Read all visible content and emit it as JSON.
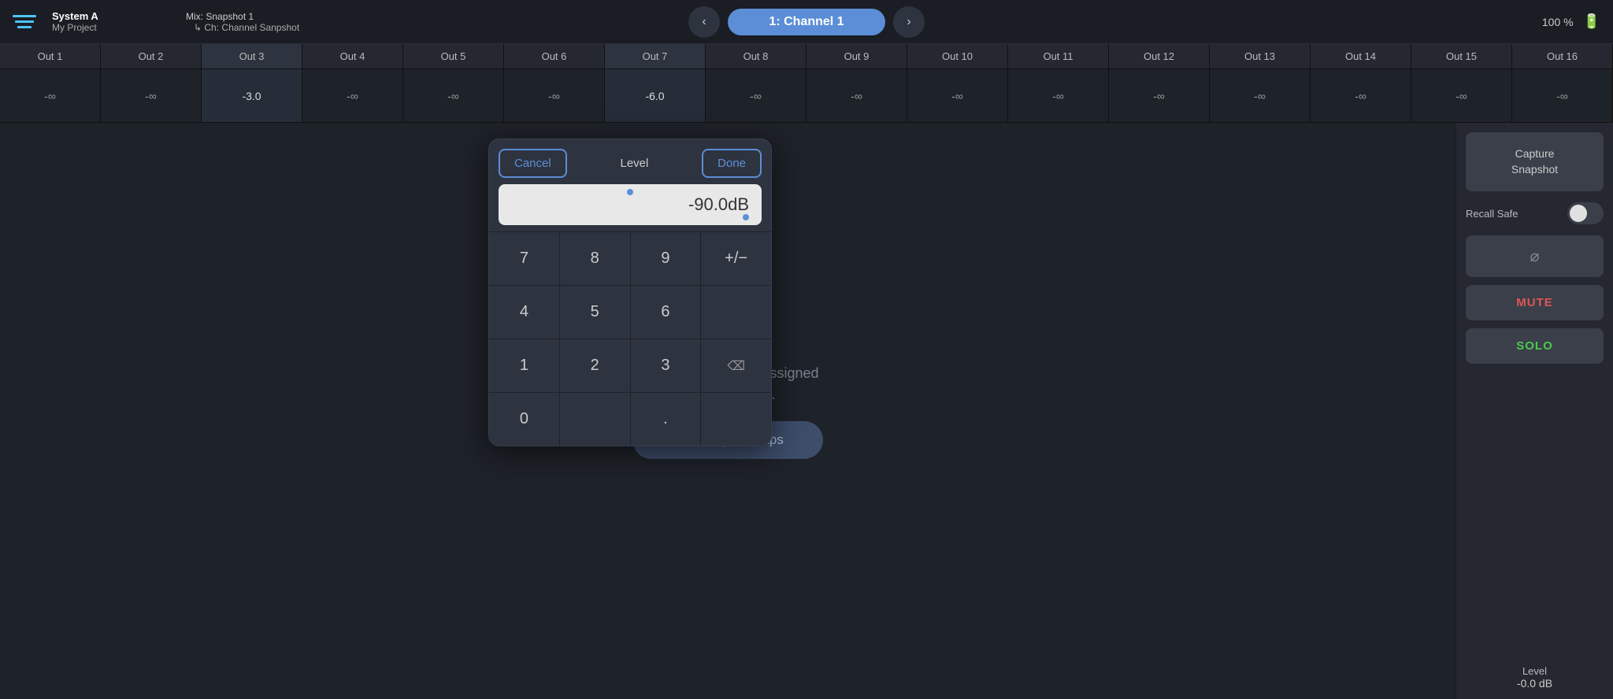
{
  "topbar": {
    "device_name": "System A",
    "project_name": "My Project",
    "mix_label": "Mix:",
    "mix_name": "Snapshot 1",
    "ch_label": "Ch:",
    "ch_name": "Channel Sanpshot",
    "prev_btn": "‹",
    "next_btn": "›",
    "channel_btn": "1: Channel 1",
    "zoom_level": "100 %",
    "battery_icon": "🔋"
  },
  "outputs": [
    {
      "label": "Out 1",
      "value": "-∞"
    },
    {
      "label": "Out 2",
      "value": "-∞"
    },
    {
      "label": "Out 3",
      "value": "-3.0"
    },
    {
      "label": "Out 4",
      "value": "-∞"
    },
    {
      "label": "Out 5",
      "value": "-∞"
    },
    {
      "label": "Out 6",
      "value": "-∞"
    },
    {
      "label": "Out 7",
      "value": "-6.0"
    },
    {
      "label": "Out 8",
      "value": "-∞"
    },
    {
      "label": "Out 9",
      "value": "-∞"
    },
    {
      "label": "Out 10",
      "value": "-∞"
    },
    {
      "label": "Out 11",
      "value": "-∞"
    },
    {
      "label": "Out 12",
      "value": "-∞"
    },
    {
      "label": "Out 13",
      "value": "-∞"
    },
    {
      "label": "Out 14",
      "value": "-∞"
    },
    {
      "label": "Out 15",
      "value": "-∞"
    },
    {
      "label": "Out 16",
      "value": "-∞"
    }
  ],
  "canvas": {
    "no_spacemaps_line1": "No Spacemaps are assigned",
    "no_spacemaps_line2": "to this channel.",
    "select_btn": "Select Spacemaps"
  },
  "right_panel": {
    "capture_snapshot": "Capture\nSnapshot",
    "recall_safe": "Recall Safe",
    "link_icon": "∞",
    "mute_label": "MUTE",
    "solo_label": "SOLO",
    "level_label": "Level",
    "level_value": "-0.0 dB"
  },
  "numpad": {
    "cancel_btn": "Cancel",
    "title": "Level",
    "done_btn": "Done",
    "display_value": "-90.0dB",
    "keys": [
      {
        "label": "7",
        "id": "key-7"
      },
      {
        "label": "8",
        "id": "key-8"
      },
      {
        "label": "9",
        "id": "key-9"
      },
      {
        "label": "+/−",
        "id": "key-plusminus"
      },
      {
        "label": "4",
        "id": "key-4"
      },
      {
        "label": "5",
        "id": "key-5"
      },
      {
        "label": "6",
        "id": "key-6"
      },
      {
        "label": "",
        "id": "key-empty1"
      },
      {
        "label": "1",
        "id": "key-1"
      },
      {
        "label": "2",
        "id": "key-2"
      },
      {
        "label": "3",
        "id": "key-3"
      },
      {
        "label": "⌫",
        "id": "key-backspace"
      },
      {
        "label": "0",
        "id": "key-0"
      },
      {
        "label": "",
        "id": "key-empty2"
      },
      {
        "label": ".",
        "id": "key-dot"
      },
      {
        "label": "",
        "id": "key-empty3"
      }
    ]
  }
}
